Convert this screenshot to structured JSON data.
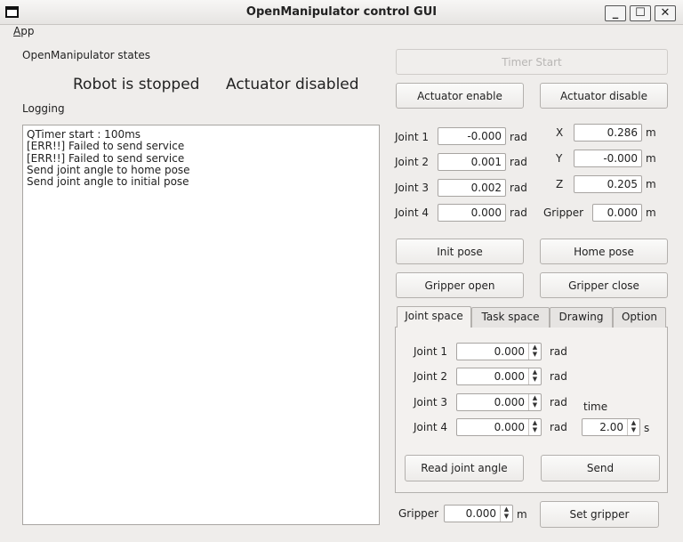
{
  "window": {
    "title": "OpenManipulator control GUI",
    "minimize": "_",
    "maximize": "☐",
    "close": "✕"
  },
  "menu": {
    "app_mnemonic": "A",
    "app_rest": "pp"
  },
  "states": {
    "heading": "OpenManipulator states",
    "robot": "Robot is stopped",
    "actuator": "Actuator disabled"
  },
  "logging": {
    "heading": "Logging",
    "lines": [
      "QTimer start : 100ms",
      "[ERR!!] Failed to send service",
      "[ERR!!] Failed to send service",
      "Send joint angle to home pose",
      "Send joint angle to initial pose"
    ]
  },
  "buttons": {
    "timer_start": "Timer Start",
    "actuator_enable": "Actuator enable",
    "actuator_disable": "Actuator disable",
    "init_pose": "Init pose",
    "home_pose": "Home pose",
    "gripper_open": "Gripper open",
    "gripper_close": "Gripper close",
    "read_joint_angle": "Read joint angle",
    "send": "Send",
    "set_gripper": "Set gripper"
  },
  "joint_readout": [
    {
      "label": "Joint 1",
      "value": "-0.000",
      "unit": "rad"
    },
    {
      "label": "Joint 2",
      "value": "0.001",
      "unit": "rad"
    },
    {
      "label": "Joint 3",
      "value": "0.002",
      "unit": "rad"
    },
    {
      "label": "Joint 4",
      "value": "0.000",
      "unit": "rad"
    }
  ],
  "task_readout": [
    {
      "label": "X",
      "value": "0.286",
      "unit": "m"
    },
    {
      "label": "Y",
      "value": "-0.000",
      "unit": "m"
    },
    {
      "label": "Z",
      "value": "0.205",
      "unit": "m"
    },
    {
      "label": "Gripper",
      "value": "0.000",
      "unit": "m"
    }
  ],
  "tabs": [
    "Joint space",
    "Task space",
    "Drawing",
    "Option"
  ],
  "joint_space": {
    "joints": [
      {
        "label": "Joint 1",
        "value": "0.000",
        "unit": "rad"
      },
      {
        "label": "Joint 2",
        "value": "0.000",
        "unit": "rad"
      },
      {
        "label": "Joint 3",
        "value": "0.000",
        "unit": "rad"
      },
      {
        "label": "Joint 4",
        "value": "0.000",
        "unit": "rad"
      }
    ],
    "time_label": "time",
    "time_value": "2.00",
    "time_unit": "s"
  },
  "gripper_set": {
    "label": "Gripper",
    "value": "0.000",
    "unit": "m"
  },
  "arrows": {
    "up": "▲",
    "down": "▼"
  }
}
